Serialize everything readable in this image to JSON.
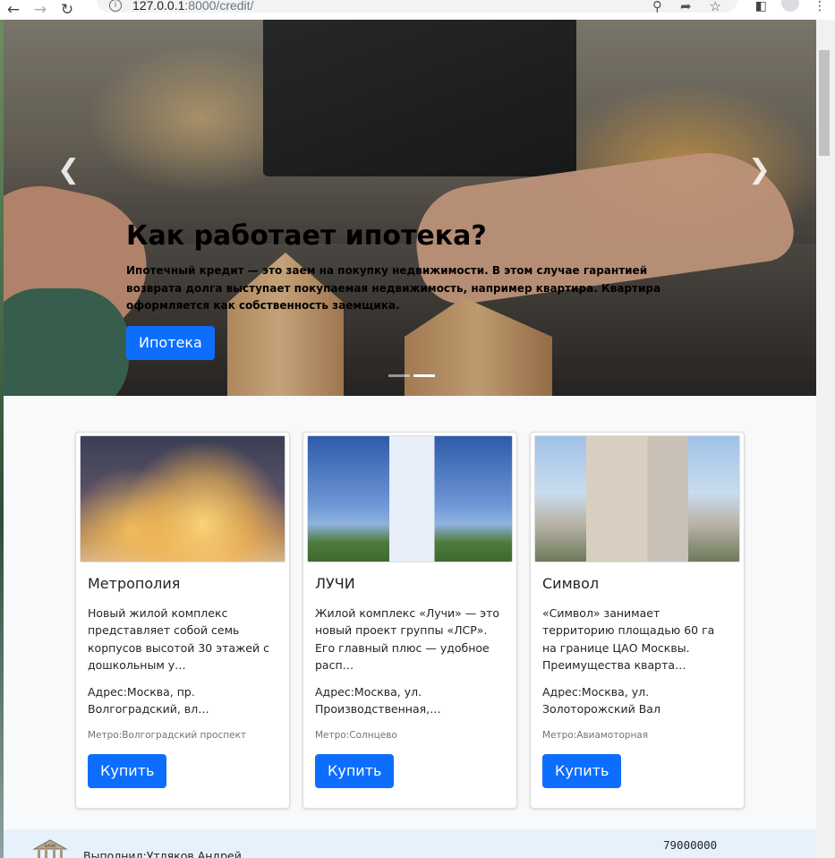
{
  "browser": {
    "url_host": "127.0.0.1",
    "url_rest": ":8000/credit/"
  },
  "carousel": {
    "title": "Как работает ипотека?",
    "text": "Ипотечный кредит — это заем на покупку недвижимости. В этом случае гарантией возврата долга выступает покупаемая недвижимость, например квартира. Квартира оформляется как собственность заемщика.",
    "button_label": "Ипотека",
    "prev_icon": "chevron-left-icon",
    "next_icon": "chevron-right-icon",
    "slides_count": 2,
    "active_slide": 2
  },
  "cards": [
    {
      "name": "Метрополия",
      "description": "Новый жилой комплекс представляет собой семь корпусов высотой 30 этажей с дошкольным у…",
      "address": "Адрес:Москва, пр. Волгоградский, вл…",
      "metro": "Метро:Волгоградский проспект",
      "button_label": "Купить"
    },
    {
      "name": "ЛУЧИ",
      "description": "Жилой комплекс «Лучи» — это новый проект группы «ЛСР». Его главный плюс — удобное расп…",
      "address": "Адрес:Москва, ул. Производственная,…",
      "metro": "Метро:Солнцево",
      "button_label": "Купить"
    },
    {
      "name": "Символ",
      "description": "«Символ» занимает территорию площадью 60 га на границе ЦАО Москвы. Преимущества кварта…",
      "address": "Адрес:Москва, ул. Золоторожский Вал",
      "metro": "Метро:Авиамоторная",
      "button_label": "Купить"
    }
  ],
  "footer": {
    "author": "Выполнил:Утляков Андрей",
    "phone": "79000000",
    "logo_text": "БАНК"
  },
  "colors": {
    "primary": "#0d6efd",
    "footer_bg": "#e7f1fb"
  }
}
